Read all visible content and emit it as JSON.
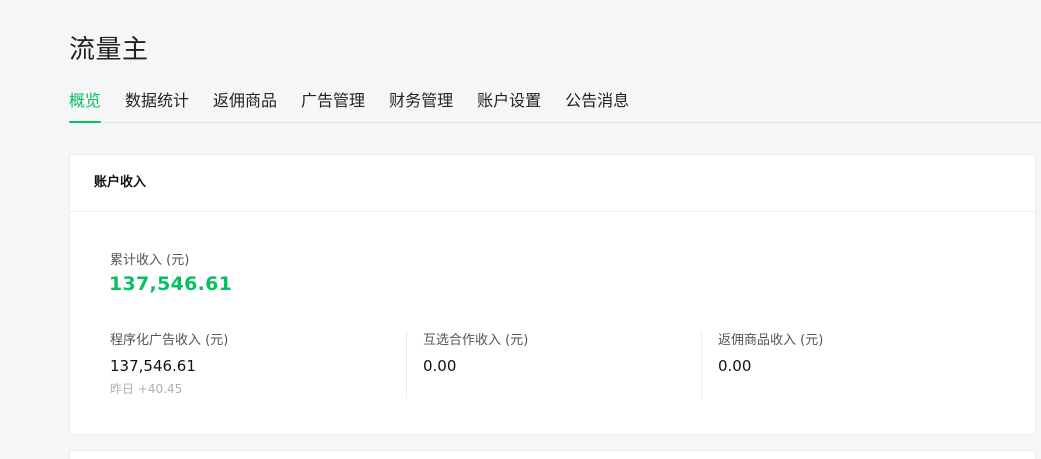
{
  "app": {
    "title": "流量主"
  },
  "tabs": [
    {
      "label": "概览",
      "active": true
    },
    {
      "label": "数据统计",
      "active": false
    },
    {
      "label": "返佣商品",
      "active": false
    },
    {
      "label": "广告管理",
      "active": false
    },
    {
      "label": "财务管理",
      "active": false
    },
    {
      "label": "账户设置",
      "active": false
    },
    {
      "label": "公告消息",
      "active": false
    }
  ],
  "account_income": {
    "header": "账户收入",
    "total_label": "累计收入 (元)",
    "total_value": "137,546.61",
    "metrics": [
      {
        "label": "程序化广告收入 (元)",
        "value": "137,546.61",
        "sub": "昨日 +40.45"
      },
      {
        "label": "互选合作收入 (元)",
        "value": "0.00"
      },
      {
        "label": "返佣商品收入 (元)",
        "value": "0.00"
      }
    ]
  },
  "colors": {
    "accent": "#07c160",
    "background": "#f5f6f7",
    "card": "#ffffff"
  }
}
